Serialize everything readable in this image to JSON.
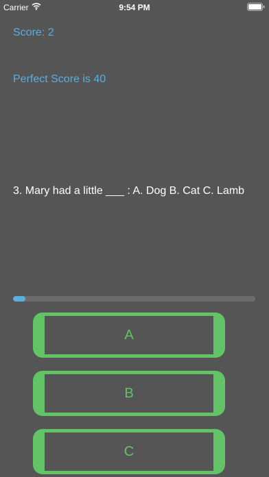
{
  "status_bar": {
    "carrier": "Carrier",
    "time": "9:54 PM",
    "wifi_icon": "wifi-icon",
    "battery_icon": "battery-icon"
  },
  "quiz": {
    "score_label": "Score: 2",
    "perfect_score_label": "Perfect Score is 40",
    "question": "3. Mary had a little ___ : A. Dog  B. Cat C. Lamb",
    "progress_fraction": 0.05
  },
  "answers": [
    {
      "label": "A"
    },
    {
      "label": "B"
    },
    {
      "label": "C"
    }
  ],
  "colors": {
    "background": "#555555",
    "accent_blue": "#5aaee0",
    "button_green": "#62c466",
    "text": "#ffffff"
  }
}
